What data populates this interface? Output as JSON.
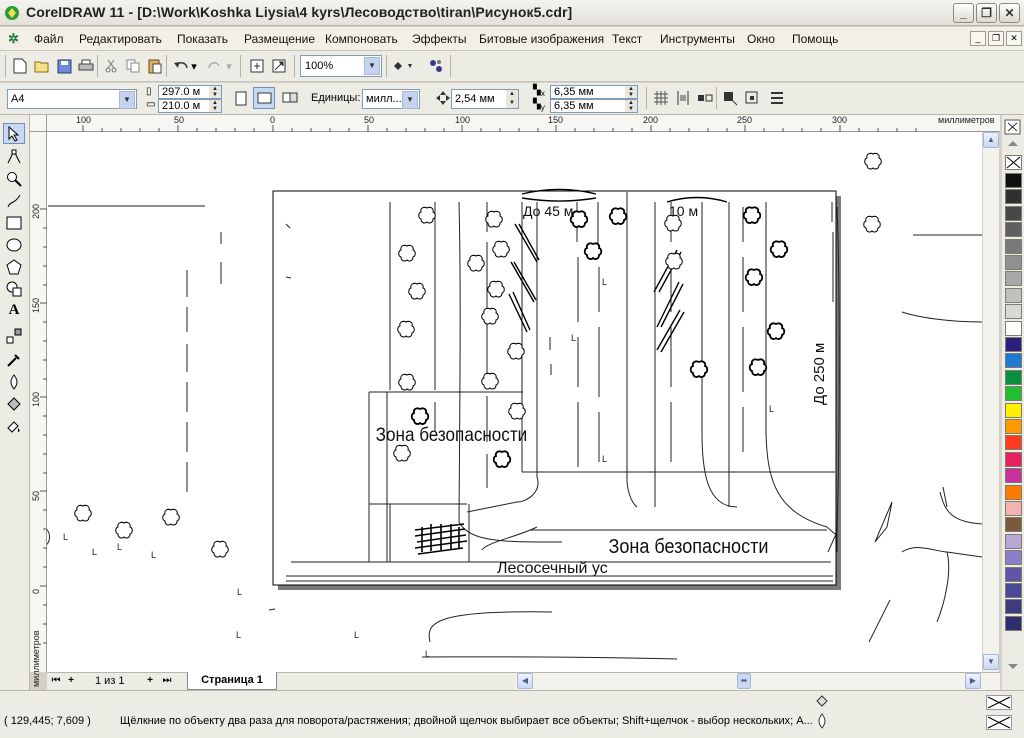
{
  "window": {
    "title": "CorelDRAW 11 - [D:\\Work\\Koshka Liysia\\4 kyrs\\Лесоводство\\tiran\\Рисунок5.cdr]"
  },
  "menu": {
    "items": [
      "Файл",
      "Редактировать",
      "Показать",
      "Размещение",
      "Компоновать",
      "Эффекты",
      "Битовые изображения",
      "Текст",
      "Инструменты",
      "Окно",
      "Помощь"
    ]
  },
  "toolbar": {
    "zoom": "100%"
  },
  "propbar": {
    "paper": "A4",
    "width": "297.0 м",
    "height": "210.0 м",
    "units_label": "Единицы:",
    "units_value": "милл...",
    "nudge": "2,54 мм",
    "dup_x": "6,35 мм",
    "dup_y": "6,35 мм",
    "x_axis": "x",
    "y_axis": "y"
  },
  "ruler": {
    "units": "миллиметров",
    "units_left": "миллиметров",
    "top_ticks": [
      "100",
      "50",
      "0",
      "50",
      "100",
      "150",
      "200",
      "250",
      "300"
    ],
    "left_ticks": [
      "200",
      "150",
      "100",
      "50",
      "0"
    ]
  },
  "drawing": {
    "label_45": "До 45 м",
    "label_10": "10 м",
    "label_250": "До 250 м",
    "zone_left": "Зона безопасности",
    "zone_bottom": "Зона безопасности",
    "plot_label": "Лесосечный ус",
    "tree_marker": "L"
  },
  "pages": {
    "counter": "1 из 1",
    "tab": "Страница 1"
  },
  "status": {
    "coords": "( 129,445; 7,609  )",
    "hint": "Щёлкние по объекту два раза для поворота/растяжения; двойной щелчок выбирает все объекты; Shift+щелчок - выбор нескольких; А..."
  },
  "palette": {
    "colors": [
      "#101010",
      "#303030",
      "#484848",
      "#606060",
      "#7a7a7a",
      "#909090",
      "#a8a8a8",
      "#c0c0c0",
      "#d8d8d8",
      "#ffffff",
      "#2a1f7a",
      "#1f7ad6",
      "#0a8f3c",
      "#1fbf2f",
      "#ffef00",
      "#ff9a00",
      "#ff3b1f",
      "#e8205f",
      "#c9309b",
      "#ff7a00",
      "#f5b2b2",
      "#7a5a3a",
      "#b7a8d8",
      "#8a7fc7",
      "#5f56a8",
      "#494996",
      "#3c3c7f",
      "#2e2e6e"
    ]
  }
}
